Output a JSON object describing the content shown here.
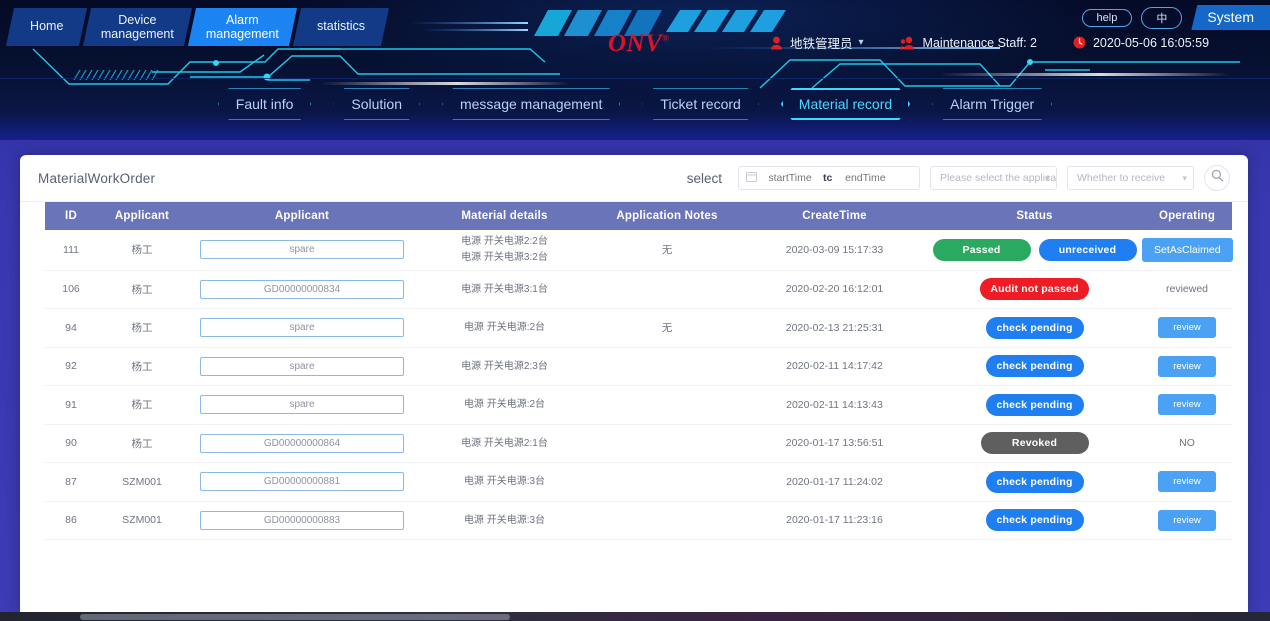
{
  "header": {
    "main_tabs": [
      {
        "label": "Home",
        "active": false
      },
      {
        "label": "Device\nmanagement",
        "line1": "Device",
        "line2": "management",
        "active": false
      },
      {
        "label": "Alarm\nmanagement",
        "line1": "Alarm",
        "line2": "management",
        "active": true
      },
      {
        "label": "statistics",
        "active": false
      }
    ],
    "brand": "ONV",
    "brand_mark": "®",
    "user_role": "地铁管理员",
    "maintenance_staff": "Maintenance Staff: 2",
    "datetime": "2020-05-06 16:05:59",
    "help_label": "help",
    "lang_label": "中",
    "system_label": "System",
    "icons": {
      "user": "user-icon",
      "staff": "staff-icon",
      "clock": "clock-icon",
      "chevron": "chevron-down-icon"
    },
    "accent_cyan": "#3fd8ff",
    "accent_blue": "#1b84f2",
    "brand_red": "#d8132a"
  },
  "subnav": [
    {
      "label": "Fault info",
      "active": false
    },
    {
      "label": "Solution",
      "active": false
    },
    {
      "label": "message management",
      "active": false
    },
    {
      "label": "Ticket record",
      "active": false
    },
    {
      "label": "Material record",
      "active": true
    },
    {
      "label": "Alarm Trigger",
      "active": false
    }
  ],
  "card": {
    "title": "MaterialWorkOrder",
    "select_label": "select",
    "start_time_placeholder": "startTime",
    "range_separator": "tc",
    "end_time_placeholder": "endTime",
    "applicant_select_placeholder": "Please select the applicar",
    "receive_select_placeholder": "Whether to receive",
    "search_icon": "search-icon",
    "calendar_icon": "calendar-icon"
  },
  "table": {
    "columns": [
      "ID",
      "Applicant",
      "Applicant",
      "Material details",
      "Application Notes",
      "CreateTime",
      "Status",
      "Operating"
    ],
    "header_bg": "#6a74b8",
    "rows": [
      {
        "id": "111",
        "applicant": "杨工",
        "order_input": "spare",
        "material": [
          "电源 开关电源2:2台",
          "电源 开关电源3:2台"
        ],
        "notes": "无",
        "create_time": "2020-03-09 15:17:33",
        "status": [
          {
            "text": "Passed",
            "style": "b-green"
          },
          {
            "text": "unreceived",
            "style": "b-blue"
          }
        ],
        "operating": {
          "type": "button",
          "text": "SetAsClaimed"
        }
      },
      {
        "id": "106",
        "applicant": "杨工",
        "order_input": "GD00000000834",
        "material": [
          "电源 开关电源3:1台"
        ],
        "notes": "",
        "create_time": "2020-02-20 16:12:01",
        "status": [
          {
            "text": "Audit not passed",
            "style": "b-red"
          }
        ],
        "operating": {
          "type": "text",
          "text": "reviewed"
        }
      },
      {
        "id": "94",
        "applicant": "杨工",
        "order_input": "spare",
        "material": [
          "电源 开关电源:2台"
        ],
        "notes": "无",
        "create_time": "2020-02-13 21:25:31",
        "status": [
          {
            "text": "check pending",
            "style": "b-blue"
          }
        ],
        "operating": {
          "type": "button",
          "text": "review"
        }
      },
      {
        "id": "92",
        "applicant": "杨工",
        "order_input": "spare",
        "material": [
          "电源 开关电源2:3台"
        ],
        "notes": "",
        "create_time": "2020-02-11 14:17:42",
        "status": [
          {
            "text": "check pending",
            "style": "b-blue"
          }
        ],
        "operating": {
          "type": "button",
          "text": "review"
        }
      },
      {
        "id": "91",
        "applicant": "杨工",
        "order_input": "spare",
        "material": [
          "电源 开关电源:2台"
        ],
        "notes": "",
        "create_time": "2020-02-11 14:13:43",
        "status": [
          {
            "text": "check pending",
            "style": "b-blue"
          }
        ],
        "operating": {
          "type": "button",
          "text": "review"
        }
      },
      {
        "id": "90",
        "applicant": "杨工",
        "order_input": "GD00000000864",
        "material": [
          "电源 开关电源2:1台"
        ],
        "notes": "",
        "create_time": "2020-01-17 13:56:51",
        "status": [
          {
            "text": "Revoked",
            "style": "b-gray"
          }
        ],
        "operating": {
          "type": "text",
          "text": "NO"
        }
      },
      {
        "id": "87",
        "applicant": "SZM001",
        "order_input": "GD00000000881",
        "material": [
          "电源 开关电源:3台"
        ],
        "notes": "",
        "create_time": "2020-01-17 11:24:02",
        "status": [
          {
            "text": "check pending",
            "style": "b-blue"
          }
        ],
        "operating": {
          "type": "button",
          "text": "review"
        }
      },
      {
        "id": "86",
        "applicant": "SZM001",
        "order_input": "GD00000000883",
        "material": [
          "电源 开关电源:3台"
        ],
        "notes": "",
        "create_time": "2020-01-17 11:23:16",
        "status": [
          {
            "text": "check pending",
            "style": "b-blue"
          }
        ],
        "operating": {
          "type": "button",
          "text": "review"
        }
      }
    ]
  }
}
